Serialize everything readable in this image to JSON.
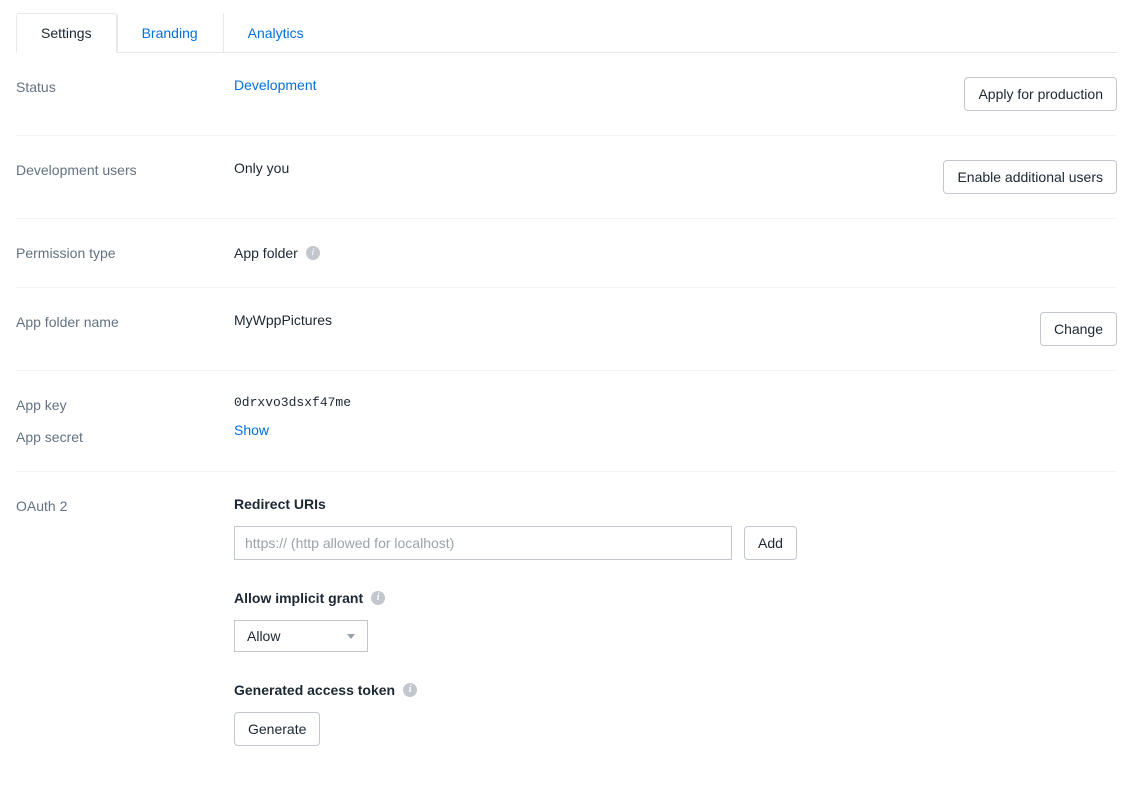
{
  "tabs": {
    "settings": "Settings",
    "branding": "Branding",
    "analytics": "Analytics"
  },
  "status": {
    "label": "Status",
    "value": "Development",
    "action": "Apply for production"
  },
  "dev_users": {
    "label": "Development users",
    "value": "Only you",
    "action": "Enable additional users"
  },
  "permission": {
    "label": "Permission type",
    "value": "App folder"
  },
  "folder": {
    "label": "App folder name",
    "value": "MyWppPictures",
    "action": "Change"
  },
  "app_key": {
    "label": "App key",
    "value": "0drxvo3dsxf47me"
  },
  "app_secret": {
    "label": "App secret",
    "action": "Show"
  },
  "oauth": {
    "label": "OAuth 2",
    "redirect_heading": "Redirect URIs",
    "redirect_placeholder": "https:// (http allowed for localhost)",
    "add": "Add",
    "implicit_heading": "Allow implicit grant",
    "implicit_value": "Allow",
    "token_heading": "Generated access token",
    "generate": "Generate"
  }
}
